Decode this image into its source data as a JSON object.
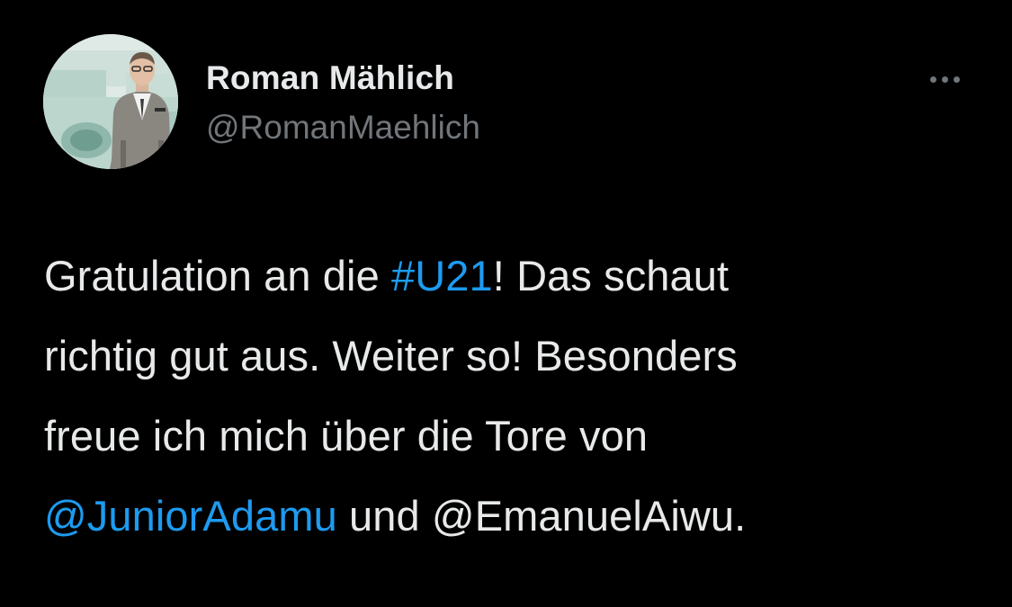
{
  "theme": {
    "background": "#000000",
    "text": "#e7e9ea",
    "secondary_text": "#71767b",
    "link": "#1d9bf0"
  },
  "author": {
    "display_name": "Roman Mählich",
    "handle": "@RomanMaehlich"
  },
  "more_icon": "more-horizontal-icon",
  "tweet": {
    "line1": {
      "before": "Gratulation an die ",
      "hashtag": "#U21",
      "after": "! Das schaut"
    },
    "line2": {
      "text": "richtig gut aus. Weiter so! Besonders"
    },
    "line3": {
      "text": "freue ich mich über die Tore von"
    },
    "line4": {
      "mention1": "@JuniorAdamu",
      "middle": " und @EmanuelAiwu."
    }
  }
}
